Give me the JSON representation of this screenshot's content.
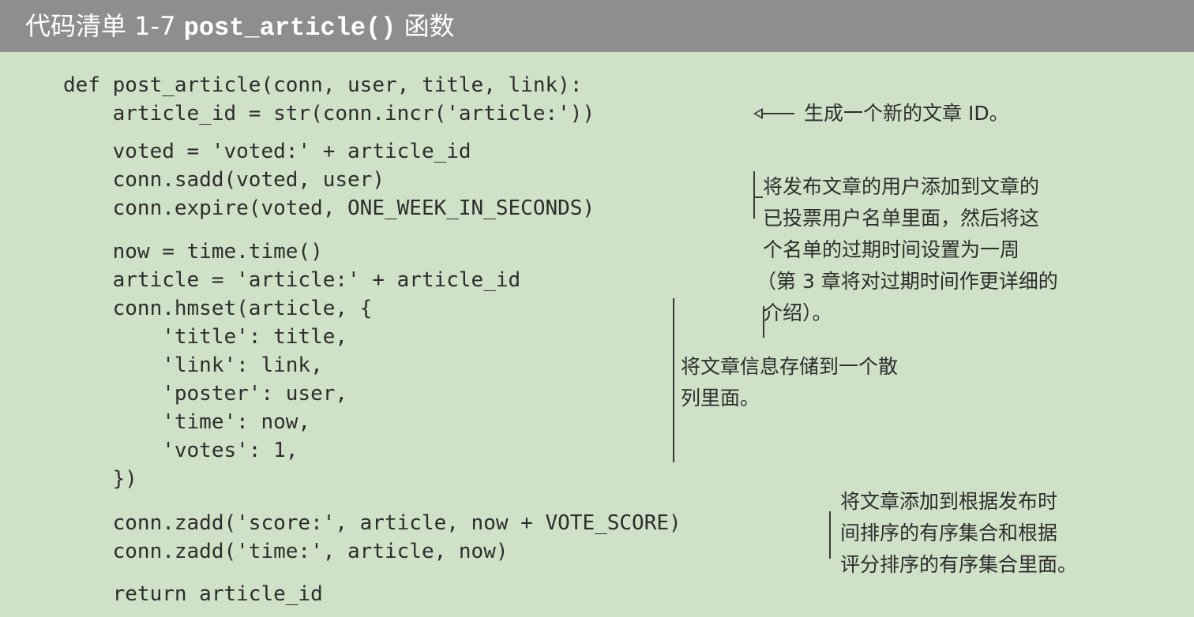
{
  "header": {
    "listing_label": "代码清单 1-7",
    "function_name": "post_article()",
    "suffix": "函数"
  },
  "code_lines": [
    "def post_article(conn, user, title, link):",
    "    article_id = str(conn.incr('article:'))",
    "    voted = 'voted:' + article_id",
    "    conn.sadd(voted, user)",
    "    conn.expire(voted, ONE_WEEK_IN_SECONDS)",
    "    now = time.time()",
    "    article = 'article:' + article_id",
    "    conn.hmset(article, {",
    "        'title': title,",
    "        'link': link,",
    "        'poster': user,",
    "        'time': now,",
    "        'votes': 1,",
    "    })",
    "    conn.zadd('score:', article, now + VOTE_SCORE)",
    "    conn.zadd('time:', article, now)",
    "    return article_id"
  ],
  "annotations": {
    "new_id": "生成一个新的文章 ID。",
    "voted_lines": [
      "将发布文章的用户添加到文章的",
      "已投票用户名单里面，然后将这",
      "个名单的过期时间设置为一周",
      "（第 3 章将对过期时间作更详细的",
      "介绍）。"
    ],
    "hash_lines": [
      "将文章信息存储到一个散",
      "列里面。"
    ],
    "zset_lines": [
      "将文章添加到根据发布时",
      "间排序的有序集合和根据",
      "评分排序的有序集合里面。"
    ]
  }
}
